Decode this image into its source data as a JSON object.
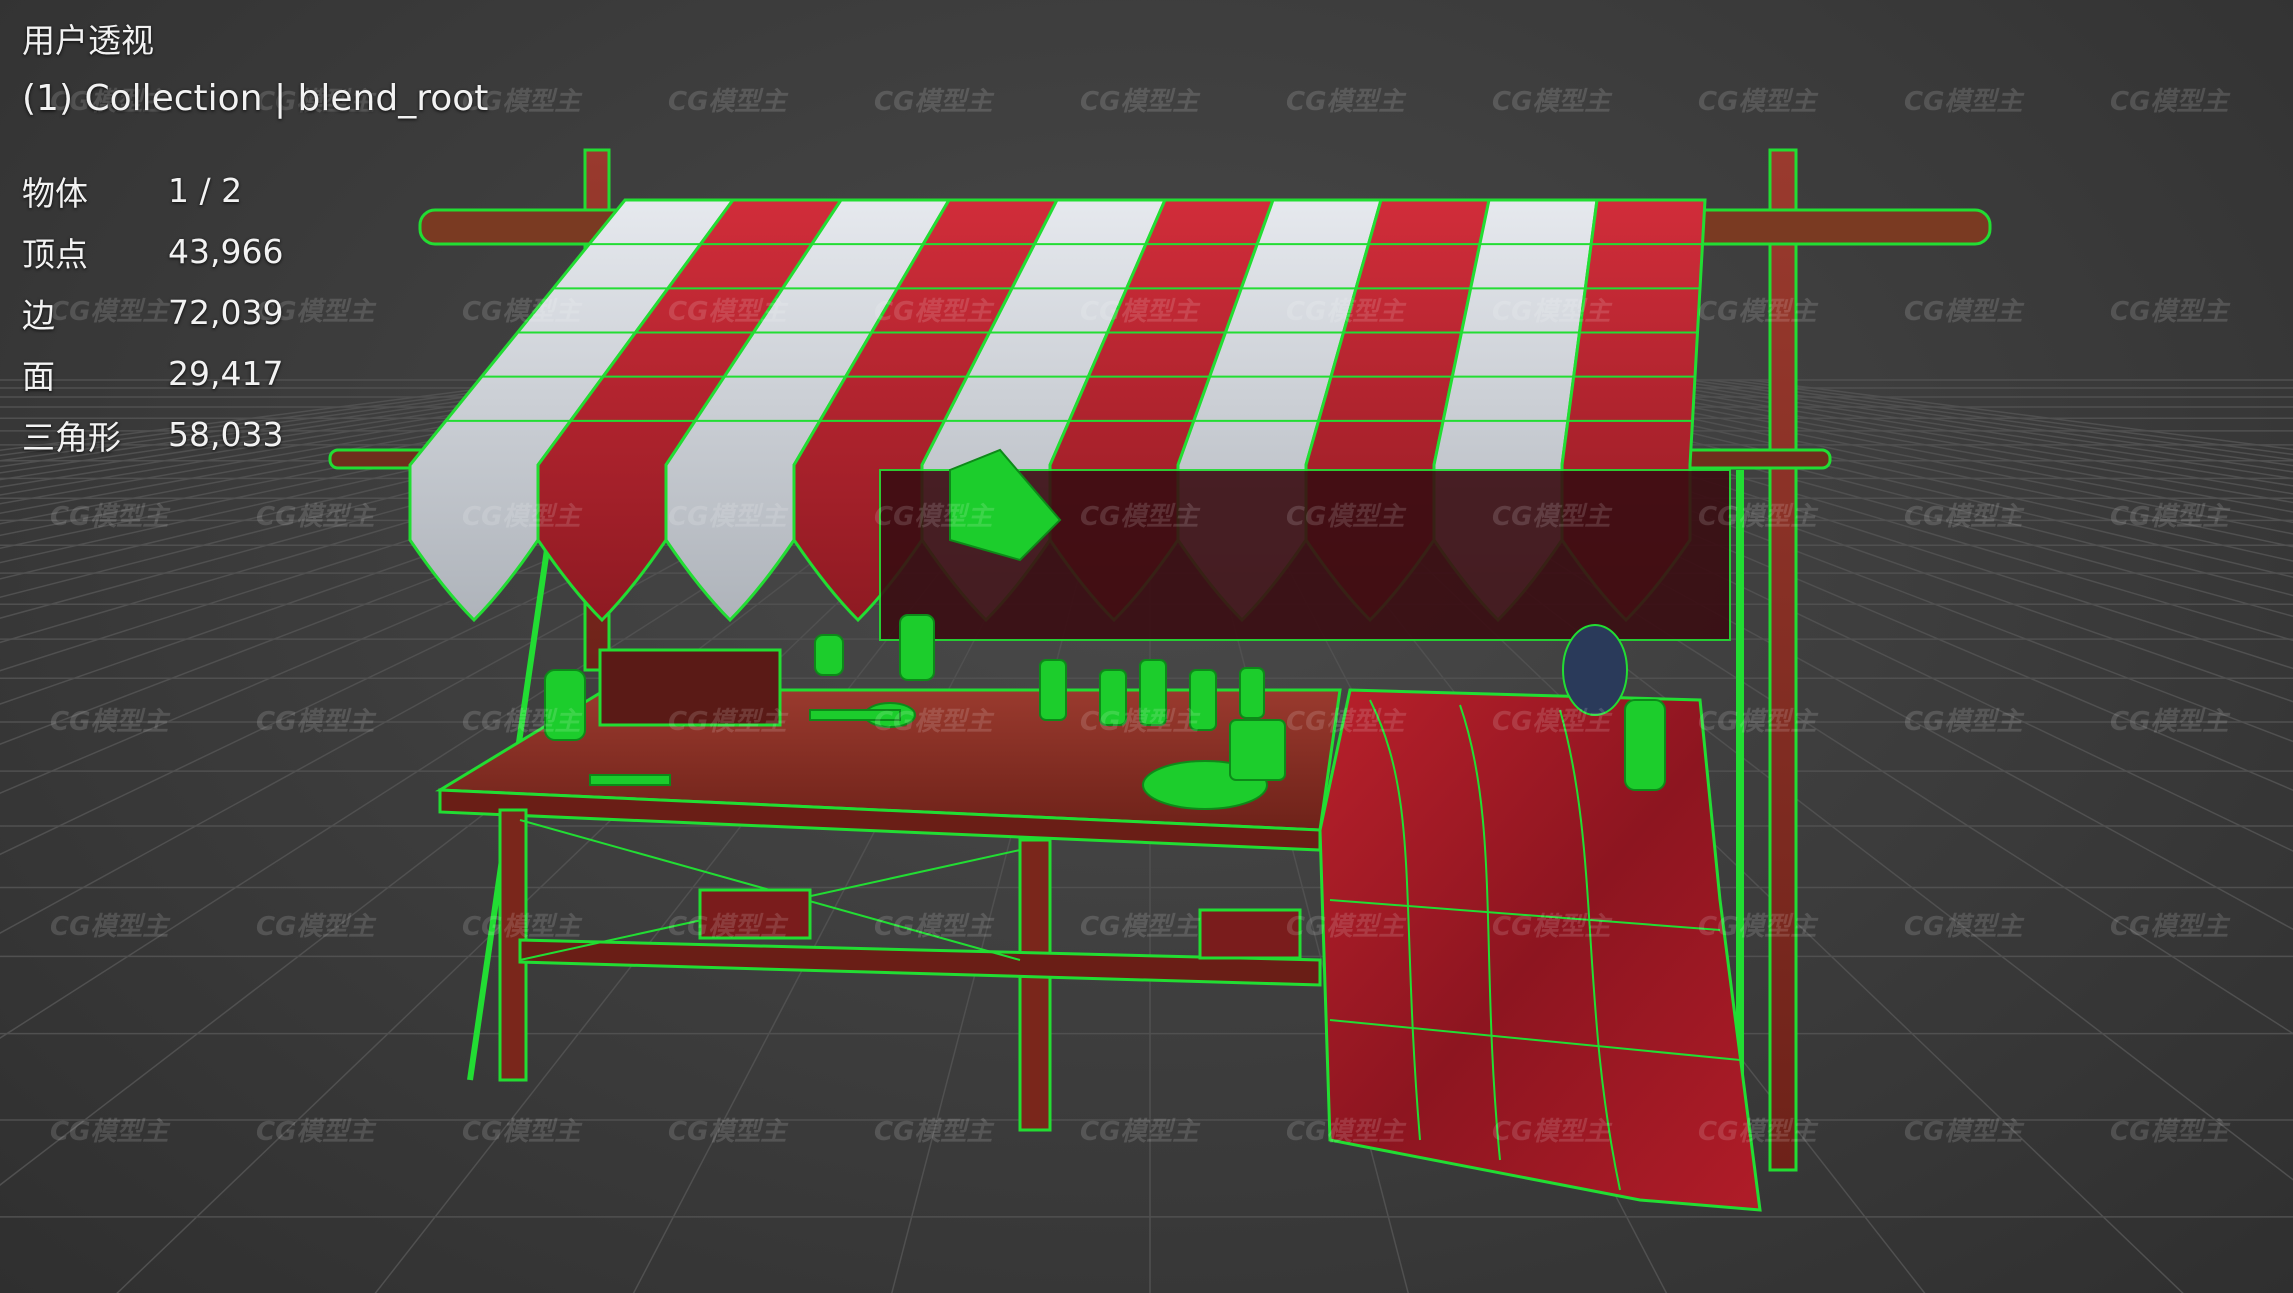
{
  "viewport": {
    "view_name": "用户透视",
    "collection_label": "(1) Collection | blend_root",
    "watermark": "CG模型主",
    "accent_wire": "#22dd33",
    "stats": [
      {
        "label": "物体",
        "value": "1 / 2"
      },
      {
        "label": "顶点",
        "value": "43,966"
      },
      {
        "label": "边",
        "value": "72,039"
      },
      {
        "label": "面",
        "value": "29,417"
      },
      {
        "label": "三角形",
        "value": "58,033"
      }
    ]
  }
}
